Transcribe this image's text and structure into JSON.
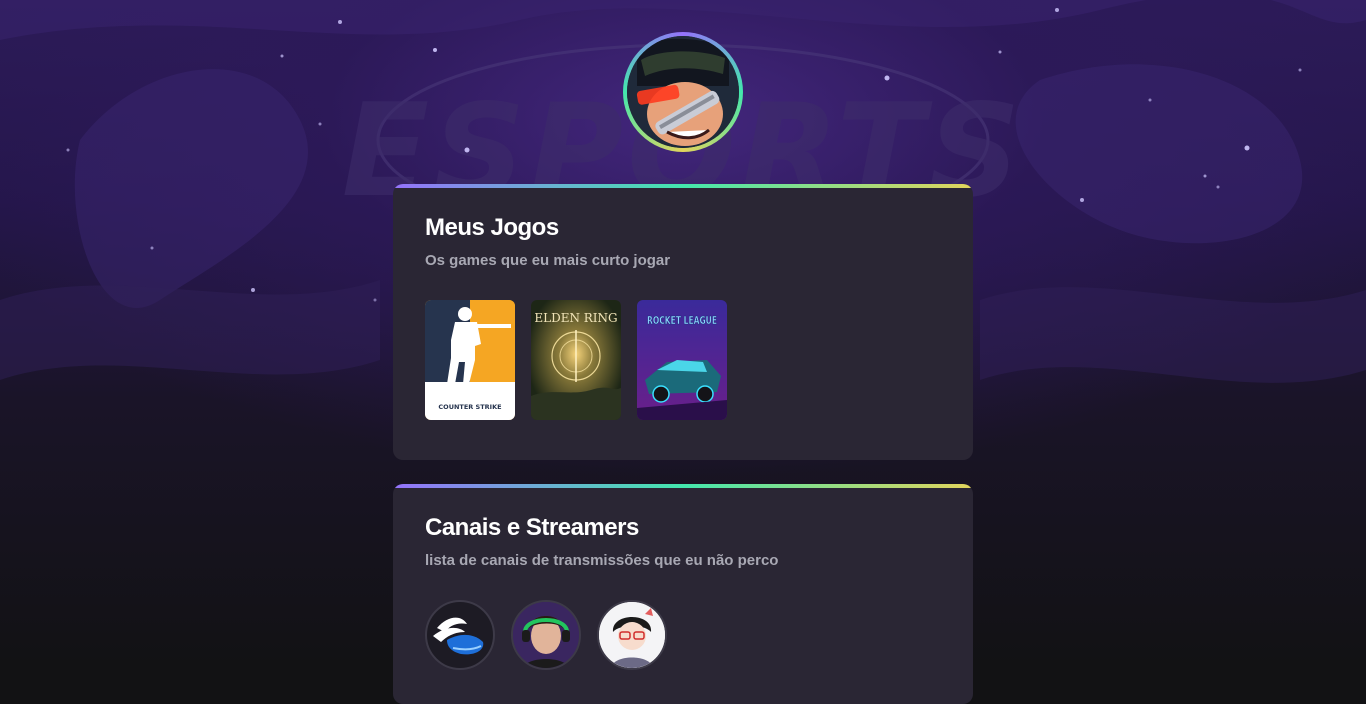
{
  "background": {
    "watermark_text": "ESPORTS"
  },
  "profile": {
    "avatar_icon": "anime-character-avatar",
    "ring_colors": [
      "#9572fc",
      "#43e7ad",
      "#e2d45c"
    ]
  },
  "games_section": {
    "title": "Meus Jogos",
    "subtitle": "Os games que eu mais curto jogar",
    "games": [
      {
        "name": "Counter-Strike",
        "logo_text": "COUNTER STRIKE"
      },
      {
        "name": "Elden Ring",
        "logo_text": "ELDEN RING"
      },
      {
        "name": "Rocket League",
        "logo_text": "ROCKET LEAGUE"
      }
    ]
  },
  "streamers_section": {
    "title": "Canais e Streamers",
    "subtitle": "lista de canais de transmissões que eu não perco",
    "streamers": [
      {
        "icon": "winged-shoe-avatar"
      },
      {
        "icon": "streamer-headset-avatar"
      },
      {
        "icon": "anime-glasses-avatar"
      }
    ]
  },
  "colors": {
    "card_bg": "#2a2634",
    "title": "#ffffff",
    "subtitle": "#a8a8b3",
    "gradient_start": "#9572fc",
    "gradient_mid": "#43e7ad",
    "gradient_end": "#e2d45c"
  }
}
